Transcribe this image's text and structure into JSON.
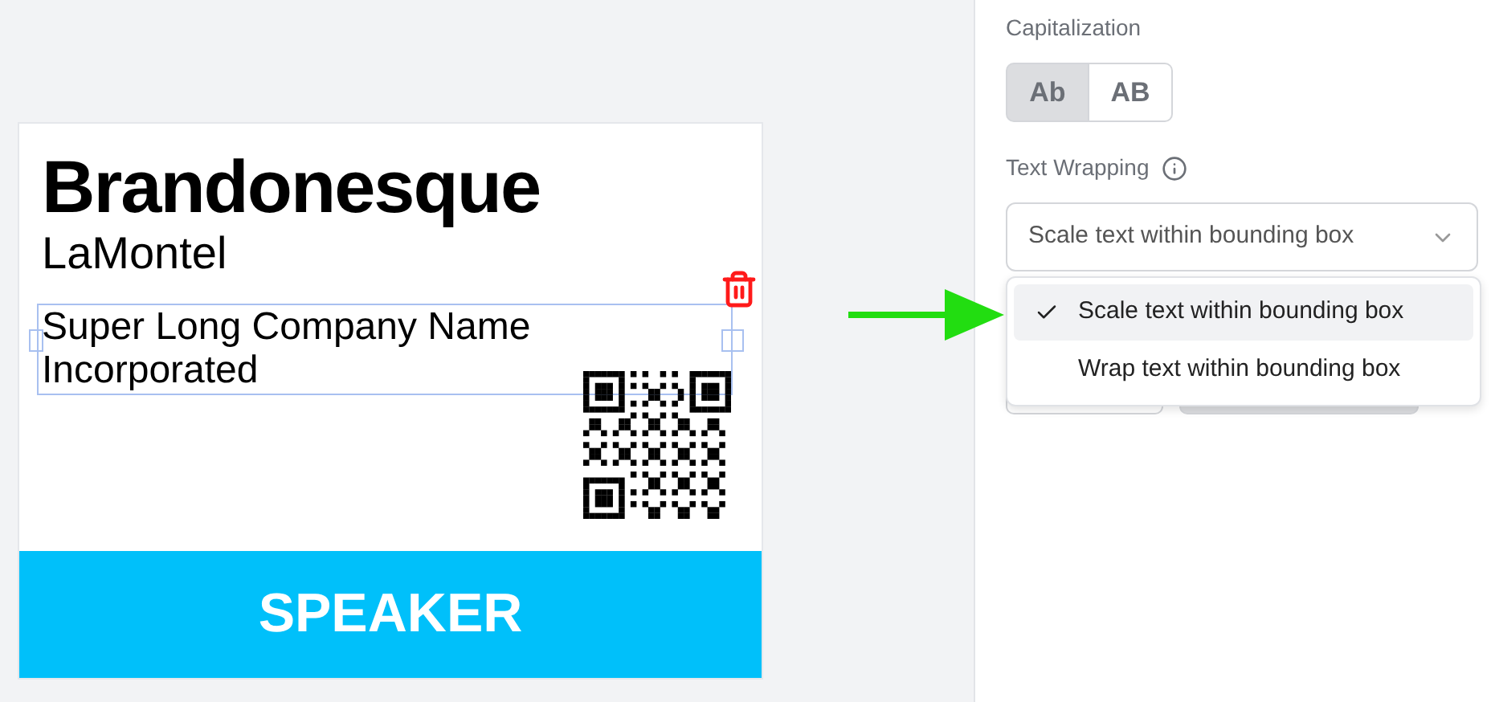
{
  "badge": {
    "name": "Brandonesque",
    "surname": "LaMontel",
    "company": "Super Long Company Name Incorporated",
    "company_selected": true,
    "role": {
      "text": "SPEAKER",
      "color": "#00c0fa"
    }
  },
  "panel": {
    "capitalization": {
      "label": "Capitalization",
      "options": [
        {
          "label": "Ab",
          "selected": true
        },
        {
          "label": "AB",
          "selected": false
        }
      ]
    },
    "text_wrapping": {
      "label": "Text Wrapping",
      "value": "Scale text within bounding box",
      "menu": [
        {
          "label": "Scale text within bounding box",
          "selected": true
        },
        {
          "label": "Wrap text within bounding box",
          "selected": false
        }
      ]
    }
  }
}
